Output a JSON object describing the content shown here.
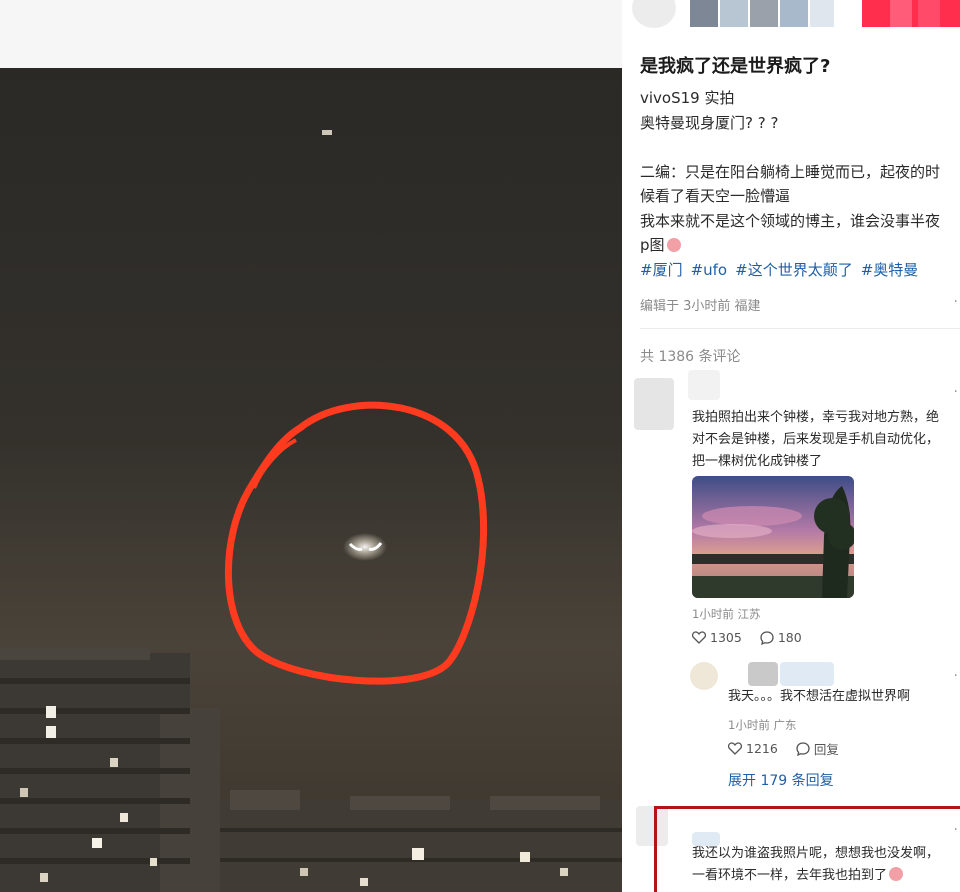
{
  "post": {
    "title": "是我疯了还是世界疯了?",
    "lines": [
      "vivoS19 实拍",
      "奥特曼现身厦门? ? ?",
      "二编：只是在阳台躺椅上睡觉而已，起夜的时",
      "候看了看天空一脸懵逼",
      "我本来就不是这个领域的博主，谁会没事半夜",
      "p图"
    ],
    "tags": [
      "#厦门",
      "#ufo",
      "#这个世界太颠了",
      "#奥特曼"
    ],
    "meta": "编辑于 3小时前 福建"
  },
  "comments_header": "共 1386 条评论",
  "comments": [
    {
      "lines": [
        "我拍照拍出来个钟楼，幸亏我对地方熟，绝",
        "对不会是钟楼，后来发现是手机自动优化，",
        "把一棵树优化成钟楼了"
      ],
      "meta": "1小时前 江苏",
      "likes": "1305",
      "replies": "180"
    },
    {
      "lines": [
        "我天。。。我不想活在虚拟世界啊"
      ],
      "meta": "1小时前 广东",
      "likes": "1216",
      "reply_label": "回复"
    },
    {
      "lines": [
        "我还以为谁盗我照片呢，想想我也没发啊，",
        "一看环境不一样，去年我也拍到了"
      ]
    }
  ],
  "expand_label": "展开 179 条回复",
  "colors": {
    "accent_red": "#ff2e4d",
    "link_blue": "#1f5fa6",
    "highlight_red": "#b3141a",
    "annotation_ring": "#ff3b1f"
  },
  "icons": [
    "heart-icon",
    "chat-bubble-icon",
    "more-dots-icon",
    "emoji-icon"
  ]
}
